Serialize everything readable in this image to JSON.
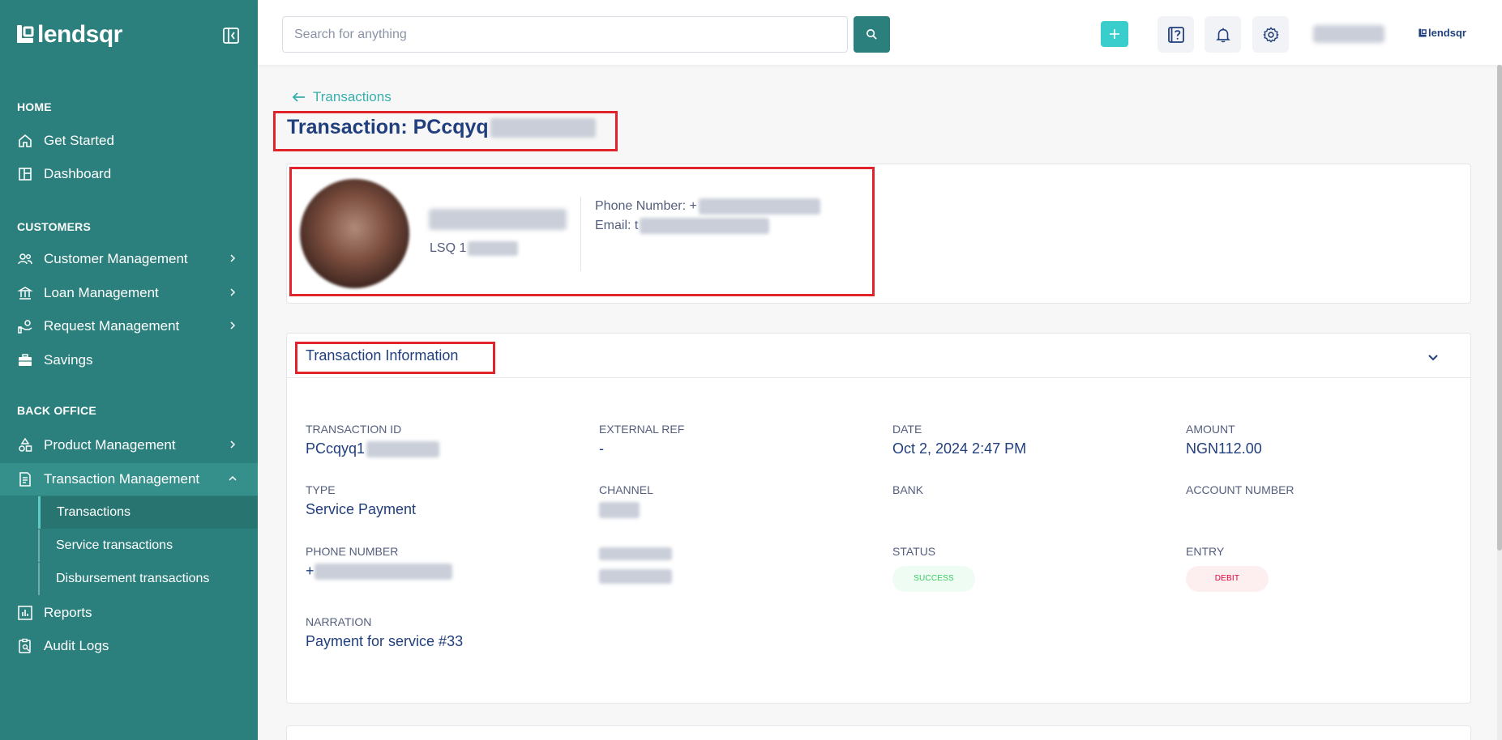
{
  "brand": {
    "name": "lendsqr",
    "mini_name": "lendsqr"
  },
  "sidebar": {
    "sections": [
      {
        "title": "HOME"
      },
      {
        "title": "CUSTOMERS"
      },
      {
        "title": "BACK OFFICE"
      }
    ],
    "items": {
      "get_started": "Get Started",
      "dashboard": "Dashboard",
      "customer_management": "Customer Management",
      "loan_management": "Loan Management",
      "request_management": "Request Management",
      "savings": "Savings",
      "product_management": "Product Management",
      "transaction_management": "Transaction Management",
      "transactions": "Transactions",
      "service_transactions": "Service transactions",
      "disbursement_transactions": "Disbursement transactions",
      "reports": "Reports",
      "audit_logs": "Audit Logs"
    }
  },
  "topbar": {
    "search_placeholder": "Search for anything"
  },
  "breadcrumb": {
    "back_label": "Transactions"
  },
  "page": {
    "title_prefix": "Transaction: PCcqyq"
  },
  "profile": {
    "id_prefix": "LSQ 1",
    "phone_label": "Phone Number: +",
    "email_label": "Email: t"
  },
  "transaction_info": {
    "title": "Transaction Information",
    "fields": {
      "transaction_id": {
        "label": "TRANSACTION ID",
        "value": "PCcqyq1"
      },
      "external_ref": {
        "label": "EXTERNAL REF",
        "value": "-"
      },
      "date": {
        "label": "DATE",
        "value": "Oct 2, 2024 2:47 PM"
      },
      "amount": {
        "label": "AMOUNT",
        "value": "NGN112.00"
      },
      "type": {
        "label": "TYPE",
        "value": "Service Payment"
      },
      "channel": {
        "label": "CHANNEL",
        "value": ""
      },
      "bank": {
        "label": "BANK",
        "value": ""
      },
      "account_number": {
        "label": "ACCOUNT NUMBER",
        "value": ""
      },
      "phone_number": {
        "label": "PHONE NUMBER",
        "value": "+"
      },
      "status": {
        "label": "STATUS",
        "value": "SUCCESS"
      },
      "entry": {
        "label": "ENTRY",
        "value": "DEBIT"
      },
      "narration": {
        "label": "NARRATION",
        "value": "Payment for service #33"
      }
    }
  },
  "colors": {
    "sidebar": "#2b7f7c",
    "accent": "#39cdcc",
    "title": "#213f7d",
    "highlight": "#e1242b",
    "success": "#39cd62",
    "debit": "#e4033b"
  }
}
